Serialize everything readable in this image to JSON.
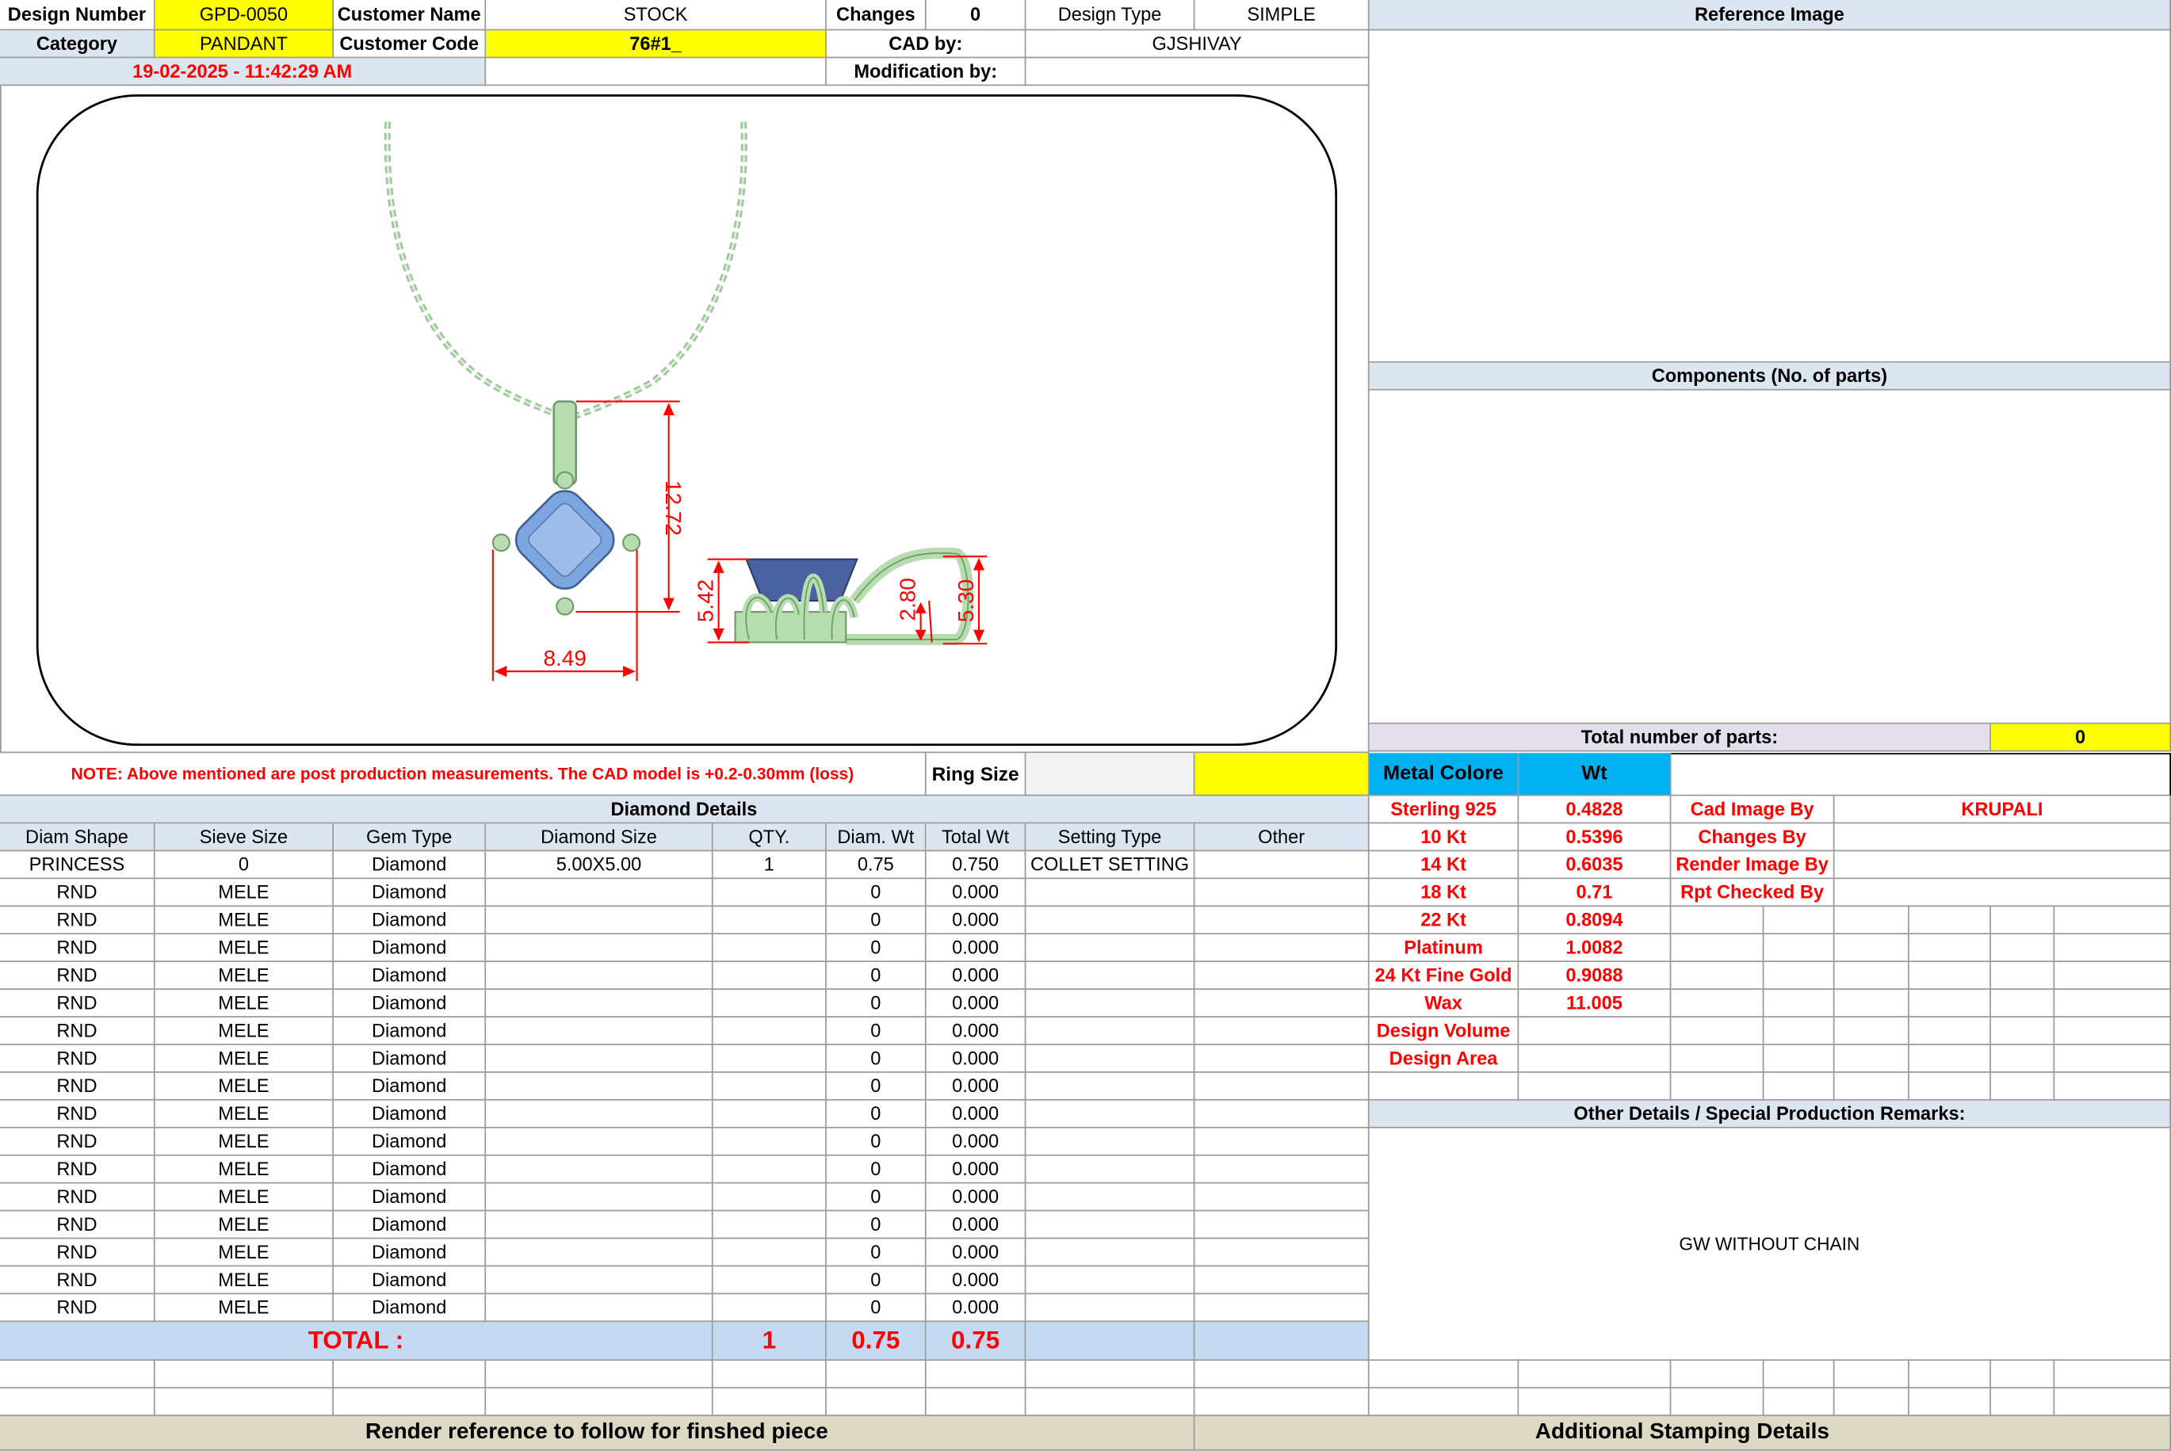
{
  "header": {
    "design_number_label": "Design Number",
    "design_number": "GPD-0050",
    "customer_name_label": "Customer Name",
    "customer_name": "STOCK",
    "changes_label": "Changes",
    "changes": "0",
    "design_type_label": "Design Type",
    "design_type": "SIMPLE",
    "category_label": "Category",
    "category": "PANDANT",
    "customer_code_label": "Customer Code",
    "customer_code": "76#1_",
    "cad_by_label": "CAD by:",
    "cad_by": "GJSHIVAY",
    "timestamp": "19-02-2025 - 11:42:29 AM",
    "modification_by_label": "Modification by:",
    "modification_by": ""
  },
  "drawing": {
    "dims": {
      "height": "12.72",
      "width": "8.49",
      "side_height": "5.42",
      "inner_height": "2.80",
      "total_height": "5.30"
    },
    "colors": {
      "metal": "#b6dcb0",
      "stone": "#7ea6de",
      "dim": "#ff0000"
    }
  },
  "note": "NOTE: Above mentioned are post production measurements. The CAD model is +0.2-0.30mm (loss)",
  "ring_size_label": "Ring Size",
  "ring_size": "",
  "reference_image_label": "Reference Image",
  "components_label": "Components (No. of parts)",
  "total_parts_label": "Total number of parts:",
  "total_parts": "0",
  "diamond_details": {
    "title": "Diamond Details",
    "columns": [
      "Diam Shape",
      "Sieve Size",
      "Gem Type",
      "Diamond Size",
      "QTY.",
      "Diam. Wt",
      "Total Wt",
      "Setting Type",
      "Other"
    ],
    "rows": [
      [
        "PRINCESS",
        "0",
        "Diamond",
        "5.00X5.00",
        "1",
        "0.75",
        "0.750",
        "COLLET SETTING",
        ""
      ],
      [
        "RND",
        "MELE",
        "Diamond",
        "",
        "",
        "0",
        "0.000",
        "",
        ""
      ],
      [
        "RND",
        "MELE",
        "Diamond",
        "",
        "",
        "0",
        "0.000",
        "",
        ""
      ],
      [
        "RND",
        "MELE",
        "Diamond",
        "",
        "",
        "0",
        "0.000",
        "",
        ""
      ],
      [
        "RND",
        "MELE",
        "Diamond",
        "",
        "",
        "0",
        "0.000",
        "",
        ""
      ],
      [
        "RND",
        "MELE",
        "Diamond",
        "",
        "",
        "0",
        "0.000",
        "",
        ""
      ],
      [
        "RND",
        "MELE",
        "Diamond",
        "",
        "",
        "0",
        "0.000",
        "",
        ""
      ],
      [
        "RND",
        "MELE",
        "Diamond",
        "",
        "",
        "0",
        "0.000",
        "",
        ""
      ],
      [
        "RND",
        "MELE",
        "Diamond",
        "",
        "",
        "0",
        "0.000",
        "",
        ""
      ],
      [
        "RND",
        "MELE",
        "Diamond",
        "",
        "",
        "0",
        "0.000",
        "",
        ""
      ],
      [
        "RND",
        "MELE",
        "Diamond",
        "",
        "",
        "0",
        "0.000",
        "",
        ""
      ],
      [
        "RND",
        "MELE",
        "Diamond",
        "",
        "",
        "0",
        "0.000",
        "",
        ""
      ],
      [
        "RND",
        "MELE",
        "Diamond",
        "",
        "",
        "0",
        "0.000",
        "",
        ""
      ],
      [
        "RND",
        "MELE",
        "Diamond",
        "",
        "",
        "0",
        "0.000",
        "",
        ""
      ],
      [
        "RND",
        "MELE",
        "Diamond",
        "",
        "",
        "0",
        "0.000",
        "",
        ""
      ],
      [
        "RND",
        "MELE",
        "Diamond",
        "",
        "",
        "0",
        "0.000",
        "",
        ""
      ],
      [
        "RND",
        "MELE",
        "Diamond",
        "",
        "",
        "0",
        "0.000",
        "",
        ""
      ]
    ],
    "total_label": "TOTAL :",
    "total_qty": "1",
    "total_diam_wt": "0.75",
    "total_wt": "0.75"
  },
  "metal": {
    "header_label": "Metal Colore",
    "wt_label": "Wt",
    "rows": [
      [
        "Sterling 925",
        "0.4828"
      ],
      [
        "10 Kt",
        "0.5396"
      ],
      [
        "14 Kt",
        "0.6035"
      ],
      [
        "18 Kt",
        "0.71"
      ],
      [
        "22 Kt",
        "0.8094"
      ],
      [
        "Platinum",
        "1.0082"
      ],
      [
        "24 Kt Fine Gold",
        "0.9088"
      ],
      [
        "Wax",
        "11.005"
      ],
      [
        "Design Volume",
        ""
      ],
      [
        "Design Area",
        ""
      ]
    ]
  },
  "credits": [
    [
      "Cad Image By",
      "KRUPALI"
    ],
    [
      "Changes By",
      ""
    ],
    [
      "Render Image By",
      ""
    ],
    [
      "Rpt Checked By",
      ""
    ]
  ],
  "other_details_label": "Other Details / Special Production Remarks:",
  "other_details": "GW WITHOUT CHAIN",
  "render_reference_label": "Render reference to follow for finshed piece",
  "stamping_label": "Additional Stamping Details"
}
